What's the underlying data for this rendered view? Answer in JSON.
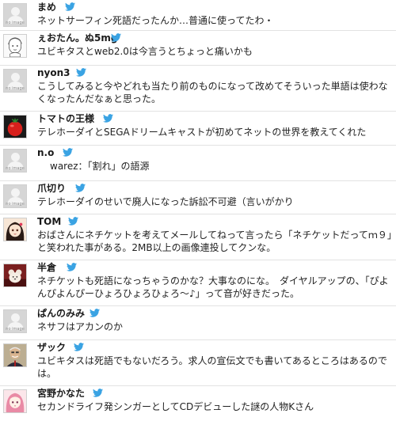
{
  "colors": {
    "bird": "#3aa3e3",
    "divider": "#e2e2e2"
  },
  "no_image_label": "no image",
  "tweets": [
    {
      "name": "まめ",
      "text": "ネットサーフィン死語だったんか…普通に使ってたわ・",
      "avatar": "no-image"
    },
    {
      "name": "ぇおたん。ぬ5mg",
      "text": "ユビキタスとweb2.0は今言うとちょっと痛いかも",
      "avatar": "sketch-portrait"
    },
    {
      "name": "nyon3",
      "text": "こうしてみると今やどれも当たり前のものになって改めてそういった単語は使わなくなったんだなぁと思った。",
      "avatar": "no-image"
    },
    {
      "name": "トマトの王様",
      "text": "テレホーダイとSEGAドリームキャストが初めてネットの世界を教えてくれた",
      "avatar": "tomato"
    },
    {
      "name": "n.o",
      "text": "warez：「割れ」の語源",
      "avatar": "no-image"
    },
    {
      "name": "爪切り",
      "text": "テレホーダイのせいで廃人になった訴訟不可避（言いがかり",
      "avatar": "no-image"
    },
    {
      "name": "TOM",
      "text": "おばさんにネチケットを考えてメールしてねって言ったら「ネチケットだってｍ９」と笑われた事がある。2MB以上の画像連投してクンな。",
      "avatar": "anime-girl"
    },
    {
      "name": "半倉",
      "text": "ネチケットも死語になっちゃうのかな？大事なのにな。　ダイヤルアップの、「ぴよんぴよんぴーひょろひょろひょろ～♪」って音が好きだった。",
      "avatar": "plush-toy"
    },
    {
      "name": "ぱんのみみ",
      "text": "ネサフはアカンのか",
      "avatar": "no-image"
    },
    {
      "name": "ザック",
      "text": "ユビキタスは死語でもないだろう。求人の宣伝文でも書いてあるところはあるのでは。",
      "avatar": "man-portrait"
    },
    {
      "name": "宮野かなた",
      "text": "セカンドライフ発シンガーとしてCDデビューした謎の人物Kさん",
      "avatar": "pink-anime"
    }
  ]
}
